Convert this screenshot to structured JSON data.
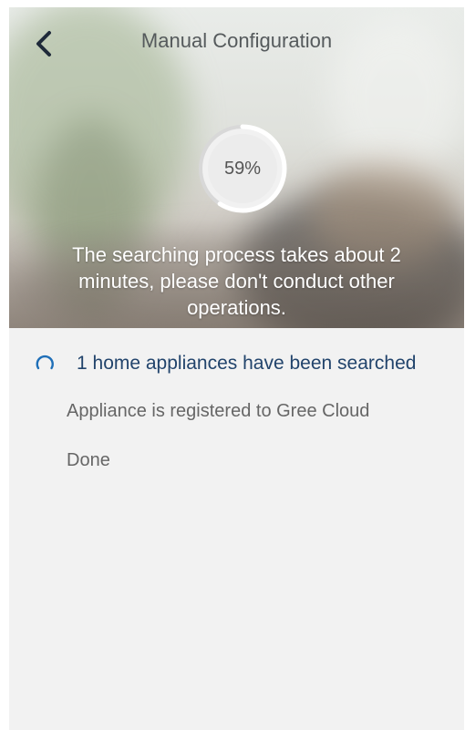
{
  "header": {
    "title": "Manual Configuration"
  },
  "progress": {
    "percent": 59,
    "label": "59%",
    "hint": "The searching process takes about 2 minutes, please don't conduct other operations."
  },
  "status": {
    "searching_text": "1 home appliances have been searched",
    "steps": [
      "Appliance is registered to Gree Cloud",
      "Done"
    ]
  },
  "colors": {
    "accent": "#1f6fb8",
    "status_text": "#22446c",
    "background": "#f2f2f2"
  }
}
